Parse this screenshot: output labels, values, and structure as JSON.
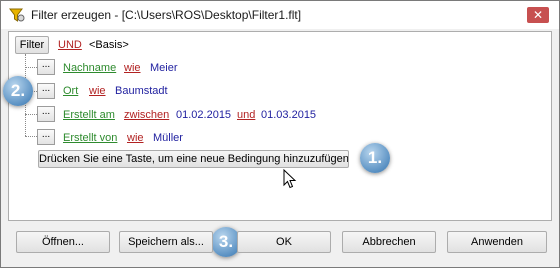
{
  "window": {
    "title": "Filter erzeugen - [C:\\Users\\ROS\\Desktop\\Filter1.flt]",
    "close_symbol": "✕"
  },
  "filter": {
    "root_button": "Filter",
    "root_operator": "UND",
    "root_base": "<Basis>",
    "row_button": "...",
    "rows": [
      {
        "field": "Nachname",
        "op": "wie",
        "value": "Meier"
      },
      {
        "field": "Ort",
        "op": "wie",
        "value": "Baumstadt"
      },
      {
        "field": "Erstellt am",
        "op": "zwischen",
        "value": "01.02.2015",
        "conj": "und",
        "value2": "01.03.2015"
      },
      {
        "field": "Erstellt von",
        "op": "wie",
        "value": "Müller"
      }
    ],
    "add_condition": "Drücken Sie eine Taste, um eine neue Bedingung hinzuzufügen"
  },
  "buttons": {
    "open": "Öffnen...",
    "save_as": "Speichern als...",
    "ok": "OK",
    "cancel": "Abbrechen",
    "apply": "Anwenden"
  },
  "callouts": [
    "1.",
    "2.",
    "3."
  ],
  "icons": {
    "app": "filter-funnel-icon",
    "close": "close-icon",
    "cursor": "mouse-pointer-icon"
  },
  "colors": {
    "field": "#2e8b2e",
    "operator": "#b22222",
    "value": "#1f1f9f",
    "badge": "#5a91c3",
    "close": "#c75050"
  }
}
